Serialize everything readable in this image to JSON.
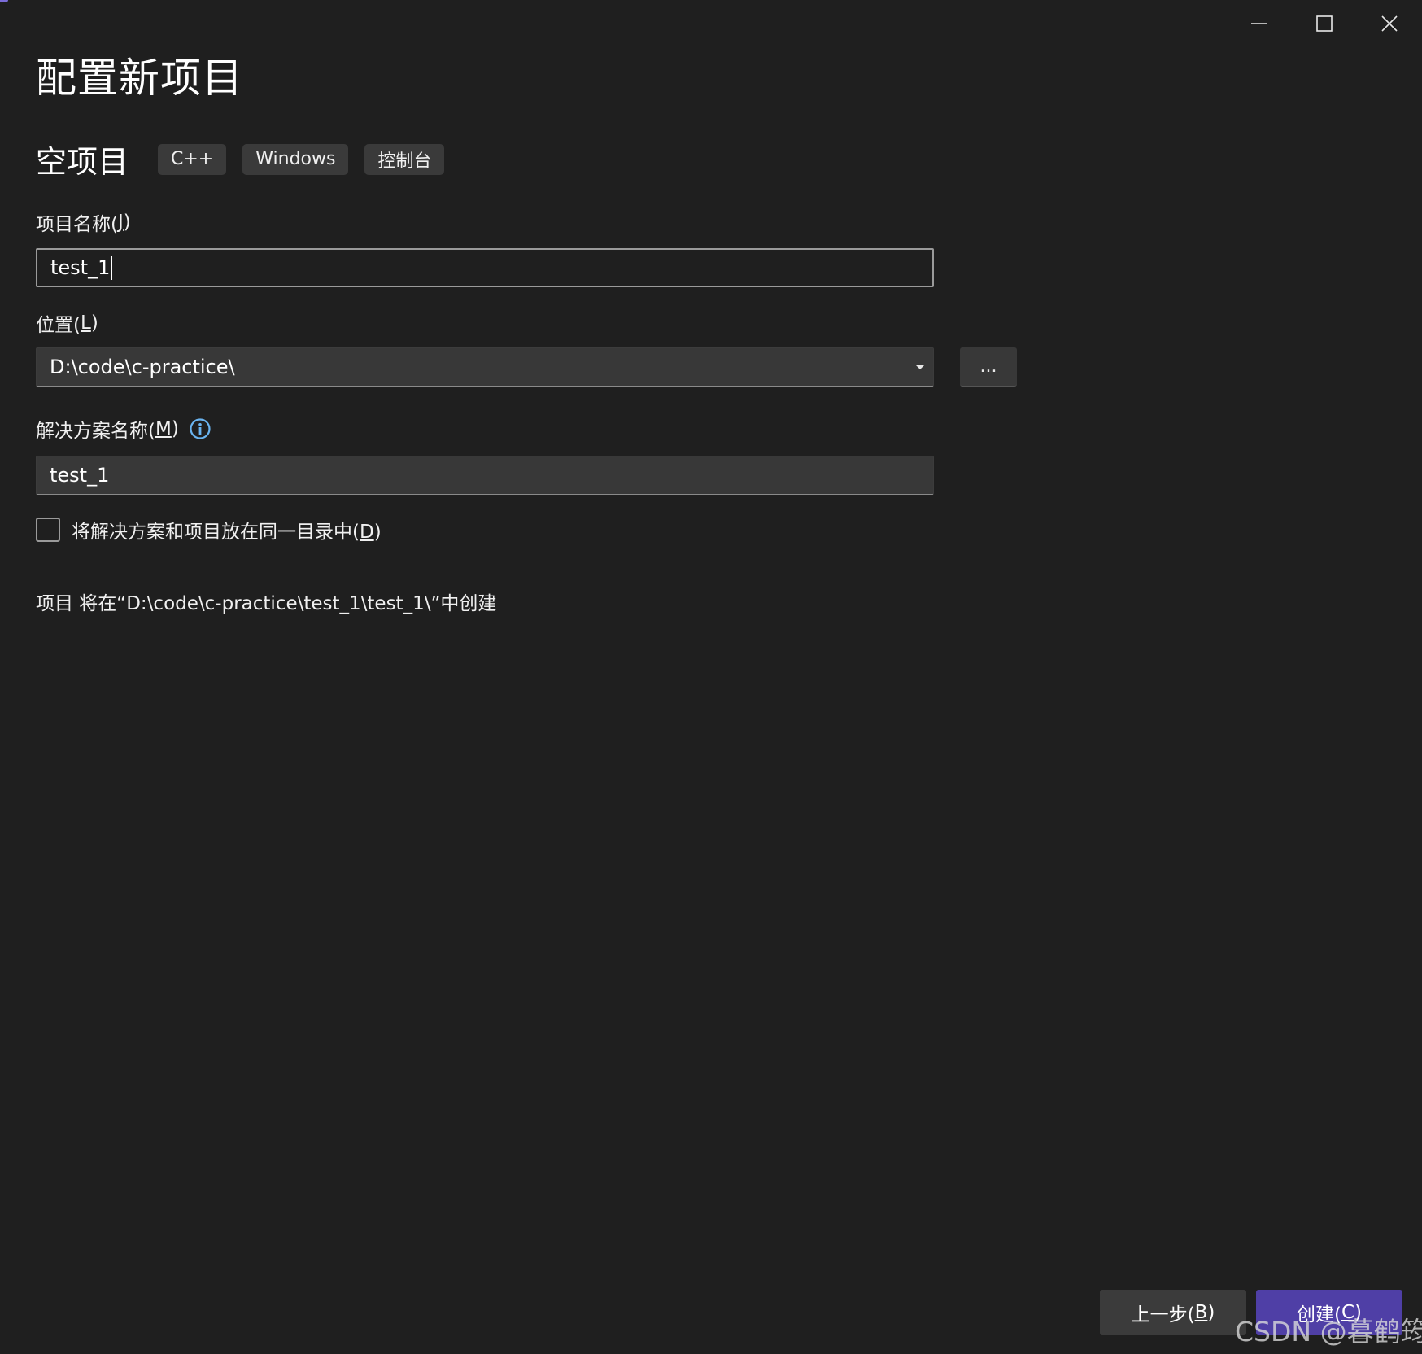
{
  "window": {
    "title": "配置新项目",
    "controls": {
      "minimize_icon": "minimize-icon",
      "maximize_icon": "maximize-icon",
      "close_icon": "close-icon"
    }
  },
  "template": {
    "name": "空项目",
    "tags": [
      "C++",
      "Windows",
      "控制台"
    ]
  },
  "project_name": {
    "label": "项目名称(J)",
    "label_main": "项目名称(",
    "label_key": "J",
    "label_end": ")",
    "value": "test_1"
  },
  "location": {
    "label_main": "位置(",
    "label_key": "L",
    "label_end": ")",
    "value": "D:\\code\\c-practice\\",
    "browse_label": "..."
  },
  "solution_name": {
    "label_main": "解决方案名称(",
    "label_key": "M",
    "label_end": ")",
    "value": "test_1",
    "info_icon": "info-icon"
  },
  "same_directory": {
    "label_main": "将解决方案和项目放在同一目录中(",
    "label_key": "D",
    "label_end": ")",
    "checked": false
  },
  "creation_info": "项目 将在“D:\\code\\c-practice\\test_1\\test_1\\”中创建",
  "buttons": {
    "back_main": "上一步(",
    "back_key": "B",
    "back_end": ")",
    "create_main": "创建(",
    "create_key": "C",
    "create_end": ")"
  },
  "watermark": "CSDN @暮鹤筠",
  "colors": {
    "background": "#1f1f1f",
    "accent": "#4f3fa6",
    "info_icon": "#6ab4f0"
  }
}
